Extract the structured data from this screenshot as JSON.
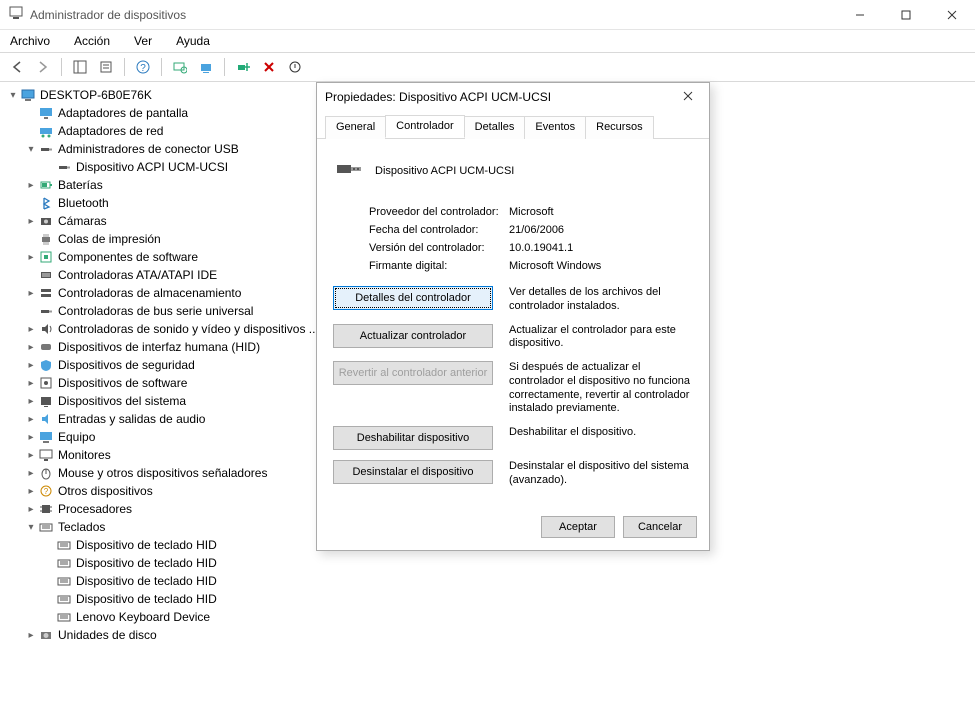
{
  "window": {
    "title": "Administrador de dispositivos"
  },
  "menubar": [
    "Archivo",
    "Acción",
    "Ver",
    "Ayuda"
  ],
  "tree": {
    "root": "DESKTOP-6B0E76K",
    "items": [
      {
        "exp": "",
        "indent": 1,
        "icon": "display",
        "label": "Adaptadores de pantalla"
      },
      {
        "exp": "",
        "indent": 1,
        "icon": "network",
        "label": "Adaptadores de red"
      },
      {
        "exp": "down",
        "indent": 1,
        "icon": "usb",
        "label": "Administradores de conector USB"
      },
      {
        "exp": "",
        "indent": 2,
        "icon": "usb",
        "label": "Dispositivo ACPI UCM-UCSI"
      },
      {
        "exp": "right",
        "indent": 1,
        "icon": "battery",
        "label": "Baterías"
      },
      {
        "exp": "",
        "indent": 1,
        "icon": "bluetooth",
        "label": "Bluetooth"
      },
      {
        "exp": "right",
        "indent": 1,
        "icon": "camera",
        "label": "Cámaras"
      },
      {
        "exp": "",
        "indent": 1,
        "icon": "printer",
        "label": "Colas de impresión"
      },
      {
        "exp": "right",
        "indent": 1,
        "icon": "component",
        "label": "Componentes de software"
      },
      {
        "exp": "",
        "indent": 1,
        "icon": "ata",
        "label": "Controladoras ATA/ATAPI IDE"
      },
      {
        "exp": "right",
        "indent": 1,
        "icon": "storage",
        "label": "Controladoras de almacenamiento"
      },
      {
        "exp": "",
        "indent": 1,
        "icon": "usb",
        "label": "Controladoras de bus serie universal"
      },
      {
        "exp": "right",
        "indent": 1,
        "icon": "sound",
        "label": "Controladoras de sonido y vídeo y dispositivos ..."
      },
      {
        "exp": "right",
        "indent": 1,
        "icon": "hid",
        "label": "Dispositivos de interfaz humana (HID)"
      },
      {
        "exp": "right",
        "indent": 1,
        "icon": "security",
        "label": "Dispositivos de seguridad"
      },
      {
        "exp": "right",
        "indent": 1,
        "icon": "software",
        "label": "Dispositivos de software"
      },
      {
        "exp": "right",
        "indent": 1,
        "icon": "system",
        "label": "Dispositivos del sistema"
      },
      {
        "exp": "right",
        "indent": 1,
        "icon": "audio",
        "label": "Entradas y salidas de audio"
      },
      {
        "exp": "right",
        "indent": 1,
        "icon": "computer",
        "label": "Equipo"
      },
      {
        "exp": "right",
        "indent": 1,
        "icon": "monitor",
        "label": "Monitores"
      },
      {
        "exp": "right",
        "indent": 1,
        "icon": "mouse",
        "label": "Mouse y otros dispositivos señaladores"
      },
      {
        "exp": "right",
        "indent": 1,
        "icon": "other",
        "label": "Otros dispositivos"
      },
      {
        "exp": "right",
        "indent": 1,
        "icon": "cpu",
        "label": "Procesadores"
      },
      {
        "exp": "down",
        "indent": 1,
        "icon": "keyboard",
        "label": "Teclados"
      },
      {
        "exp": "",
        "indent": 2,
        "icon": "keyboard",
        "label": "Dispositivo de teclado HID"
      },
      {
        "exp": "",
        "indent": 2,
        "icon": "keyboard",
        "label": "Dispositivo de teclado HID"
      },
      {
        "exp": "",
        "indent": 2,
        "icon": "keyboard",
        "label": "Dispositivo de teclado HID"
      },
      {
        "exp": "",
        "indent": 2,
        "icon": "keyboard",
        "label": "Dispositivo de teclado HID"
      },
      {
        "exp": "",
        "indent": 2,
        "icon": "keyboard",
        "label": "Lenovo Keyboard Device"
      },
      {
        "exp": "right",
        "indent": 1,
        "icon": "disk",
        "label": "Unidades de disco"
      }
    ]
  },
  "dialog": {
    "title": "Propiedades: Dispositivo ACPI UCM-UCSI",
    "tabs": [
      "General",
      "Controlador",
      "Detalles",
      "Eventos",
      "Recursos"
    ],
    "activeTab": 1,
    "deviceName": "Dispositivo ACPI UCM-UCSI",
    "info": [
      {
        "label": "Proveedor del controlador:",
        "value": "Microsoft"
      },
      {
        "label": "Fecha del controlador:",
        "value": "21/06/2006"
      },
      {
        "label": "Versión del controlador:",
        "value": "10.0.19041.1"
      },
      {
        "label": "Firmante digital:",
        "value": "Microsoft Windows"
      }
    ],
    "actions": [
      {
        "label": "Detalles del controlador",
        "desc": "Ver detalles de los archivos del controlador instalados.",
        "state": "highlight"
      },
      {
        "label": "Actualizar controlador",
        "desc": "Actualizar el controlador para este dispositivo.",
        "state": ""
      },
      {
        "label": "Revertir al controlador anterior",
        "desc": "Si después de actualizar el controlador el dispositivo no funciona correctamente, revertir al controlador instalado previamente.",
        "state": "disabled"
      },
      {
        "label": "Deshabilitar dispositivo",
        "desc": "Deshabilitar el dispositivo.",
        "state": ""
      },
      {
        "label": "Desinstalar el dispositivo",
        "desc": "Desinstalar el dispositivo del sistema (avanzado).",
        "state": ""
      }
    ],
    "buttons": {
      "ok": "Aceptar",
      "cancel": "Cancelar"
    }
  }
}
